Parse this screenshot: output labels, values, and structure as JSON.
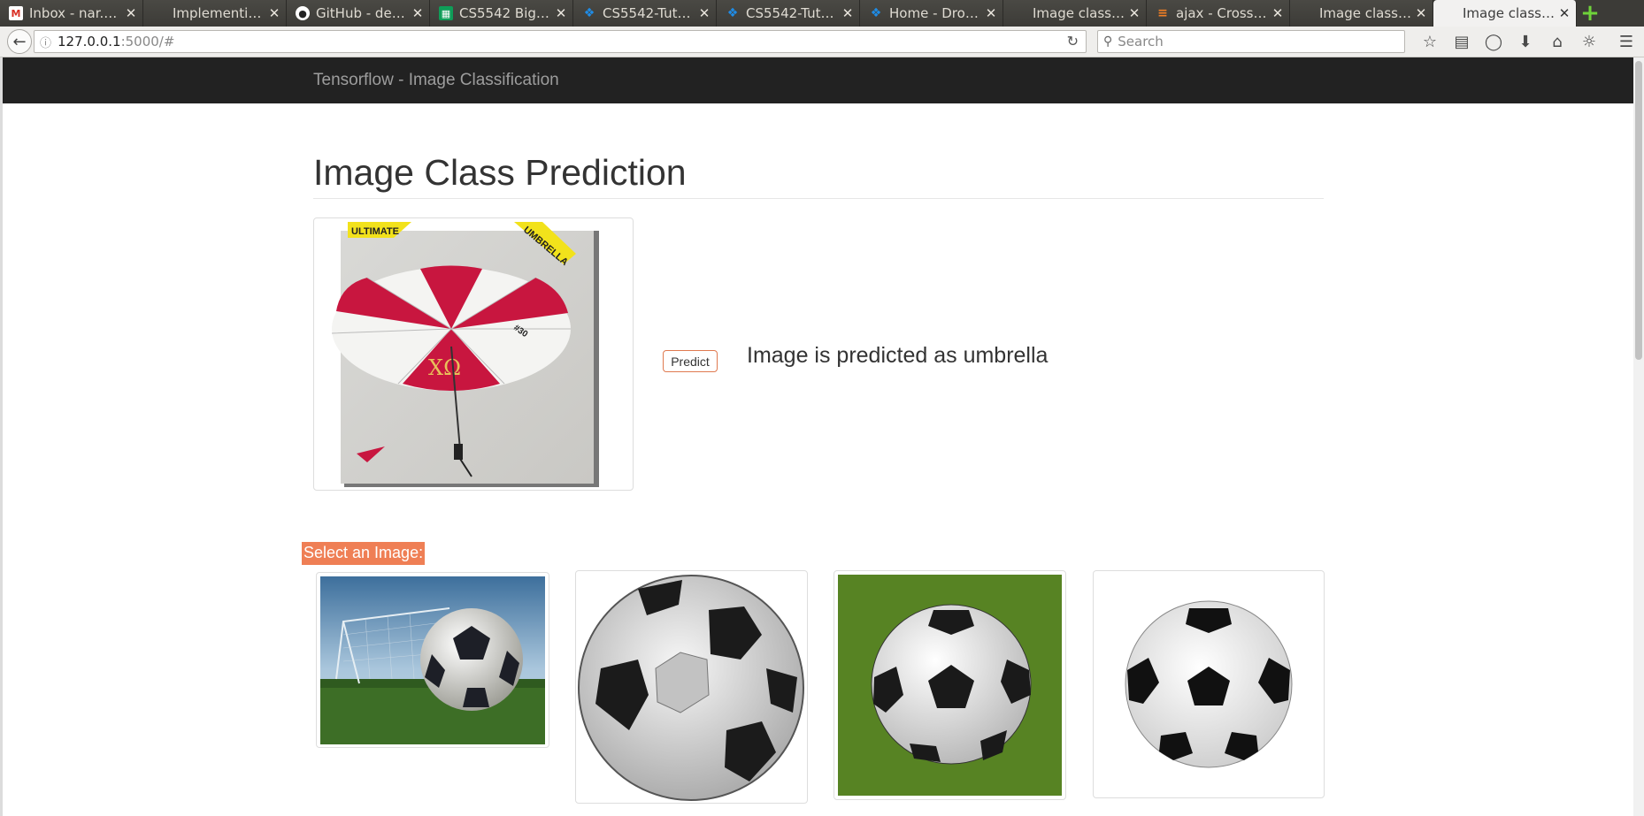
{
  "browser": {
    "tabs": [
      {
        "title": "Inbox - nar.ac...",
        "icon": "gmail-icon",
        "active": false
      },
      {
        "title": "Implementing a ...",
        "icon": "blank-page-icon",
        "active": false
      },
      {
        "title": "GitHub - den...",
        "icon": "github-icon",
        "active": false
      },
      {
        "title": "CS5542 Big D...",
        "icon": "sheets-icon",
        "active": false
      },
      {
        "title": "CS5542-Tuto...",
        "icon": "dropbox-icon",
        "active": false
      },
      {
        "title": "CS5542-Tuto...",
        "icon": "dropbox-icon",
        "active": false
      },
      {
        "title": "Home - Drop...",
        "icon": "dropbox-icon",
        "active": false
      },
      {
        "title": "Image classifica...",
        "icon": "blank-page-icon",
        "active": false
      },
      {
        "title": "ajax - Cross-...",
        "icon": "stackoverflow-icon",
        "active": false
      },
      {
        "title": "Image classifica...",
        "icon": "blank-page-icon",
        "active": false
      },
      {
        "title": "Image classifica...",
        "icon": "blank-page-icon",
        "active": true
      }
    ],
    "url_host": "127.0.0.1",
    "url_path": ":5000/#",
    "search_placeholder": "Search"
  },
  "site": {
    "brand": "Tensorflow - Image Classification",
    "heading": "Image Class Prediction",
    "predict_label": "Predict",
    "result_text": "Image is predicted as umbrella",
    "select_label": "Select an Image:",
    "umbrella_banner_left": "ULTIMATE",
    "umbrella_banner_right": "UMBRELLA",
    "umbrella_letters": "ΧΩ",
    "umbrella_number": "#30"
  },
  "colors": {
    "navbar_bg": "#222222",
    "brand_text": "#9d9d9d",
    "select_label_bg": "#ef7f55",
    "predict_border": "#e07a50",
    "umbrella_red": "#c8163f"
  }
}
